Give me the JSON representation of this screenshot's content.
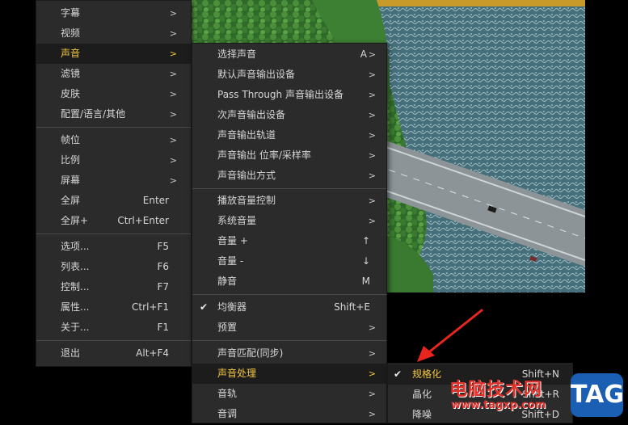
{
  "main_menu": {
    "items": [
      {
        "label": "字幕",
        "arrow": ">"
      },
      {
        "label": "视频",
        "arrow": ">"
      },
      {
        "label": "声音",
        "arrow": ">"
      },
      {
        "label": "滤镜",
        "arrow": ">"
      },
      {
        "label": "皮肤",
        "arrow": ">"
      },
      {
        "label": "配置/语言/其他",
        "arrow": ">"
      },
      {
        "label": "帧位",
        "arrow": ">"
      },
      {
        "label": "比例",
        "arrow": ">"
      },
      {
        "label": "屏幕",
        "arrow": ">"
      },
      {
        "label": "全屏",
        "shortcut": "Enter"
      },
      {
        "label": "全屏+",
        "shortcut": "Ctrl+Enter"
      },
      {
        "label": "选项...",
        "shortcut": "F5"
      },
      {
        "label": "列表...",
        "shortcut": "F6"
      },
      {
        "label": "控制...",
        "shortcut": "F7"
      },
      {
        "label": "属性...",
        "shortcut": "Ctrl+F1"
      },
      {
        "label": "关于...",
        "shortcut": "F1"
      },
      {
        "label": "退出",
        "shortcut": "Alt+F4"
      }
    ]
  },
  "sound_menu": {
    "items": [
      {
        "label": "选择声音",
        "shortcut": "A",
        "arrow": ">"
      },
      {
        "label": "默认声音输出设备",
        "arrow": ">"
      },
      {
        "label": "Pass Through 声音输出设备",
        "arrow": ">"
      },
      {
        "label": "次声音输出设备",
        "arrow": ">"
      },
      {
        "label": "声音输出轨道",
        "arrow": ">"
      },
      {
        "label": "声音输出 位率/采样率",
        "arrow": ">"
      },
      {
        "label": "声音输出方式",
        "arrow": ">"
      },
      {
        "label": "播放音量控制",
        "arrow": ">"
      },
      {
        "label": "系统音量",
        "arrow": ">"
      },
      {
        "label": "音量 +",
        "shortcut": "↑"
      },
      {
        "label": "音量 -",
        "shortcut": "↓"
      },
      {
        "label": "静音",
        "shortcut": "M"
      },
      {
        "label": "均衡器",
        "shortcut": "Shift+E",
        "check": "✔"
      },
      {
        "label": "预置",
        "arrow": ">"
      },
      {
        "label": "声音匹配(同步)",
        "arrow": ">"
      },
      {
        "label": "声音处理",
        "arrow": ">"
      },
      {
        "label": "音轨",
        "arrow": ">"
      },
      {
        "label": "音调",
        "arrow": ">"
      }
    ]
  },
  "process_menu": {
    "items": [
      {
        "label": "规格化",
        "shortcut": "Shift+N",
        "check": "✔"
      },
      {
        "label": "晶化",
        "shortcut": "Shift+R"
      },
      {
        "label": "降噪",
        "shortcut": "Shift+D"
      }
    ]
  },
  "watermark": {
    "site_name": "电脑技术网",
    "url": "www.tagxp.com",
    "tag": "TAG"
  },
  "colors": {
    "menu_bg": "#2b2b2b",
    "active_text": "#f3c63f",
    "watermark_red": "#e0312b",
    "tag_blue": "#1a5fb4"
  }
}
